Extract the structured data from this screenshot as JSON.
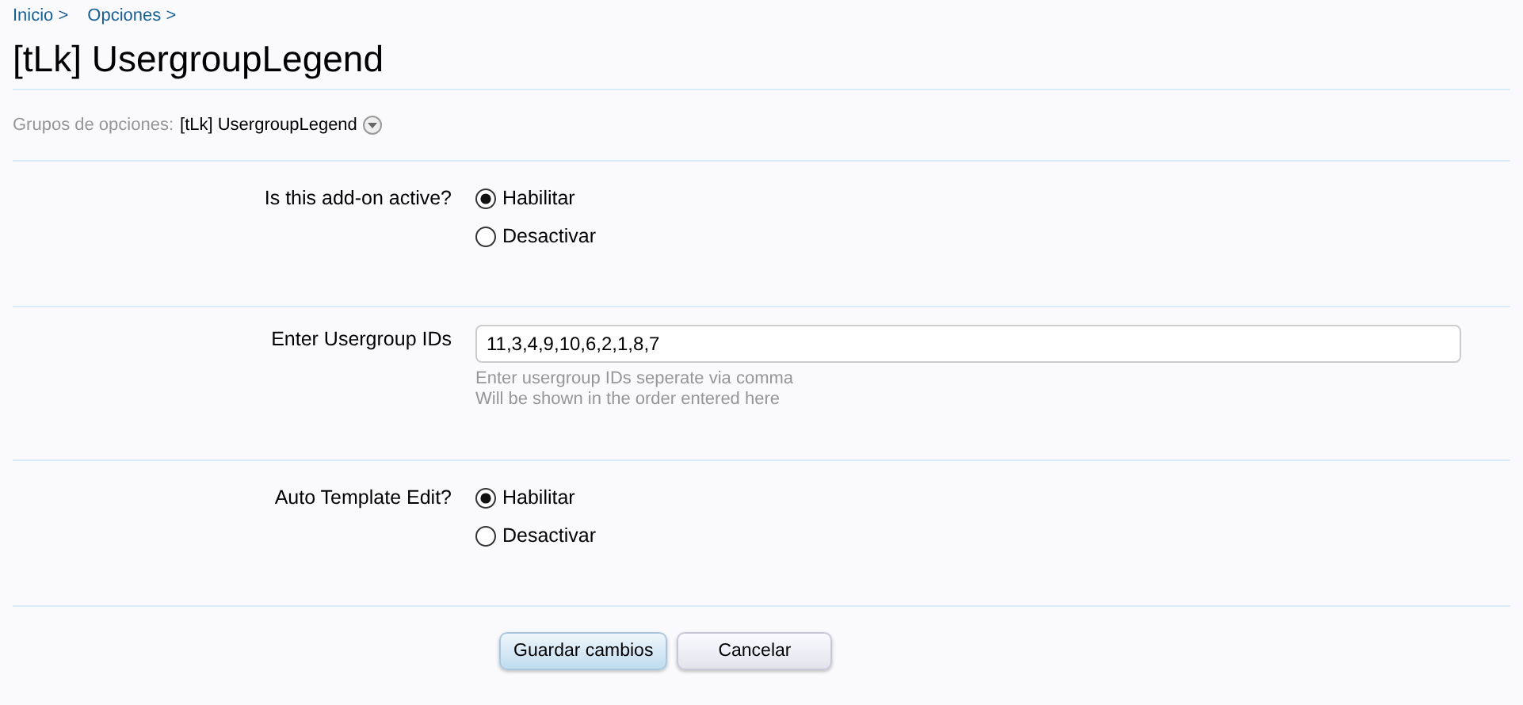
{
  "breadcrumb": [
    "Inicio >",
    "Opciones >"
  ],
  "title": "[tLk] UsergroupLegend",
  "option_group": {
    "label": "Grupos de opciones:",
    "value": "[tLk] UsergroupLegend"
  },
  "options": [
    {
      "kind": "radio",
      "label": "Is this add-on active?",
      "choices": [
        {
          "label": "Habilitar",
          "selected": true
        },
        {
          "label": "Desactivar",
          "selected": false
        }
      ]
    },
    {
      "kind": "text",
      "label": "Enter Usergroup IDs",
      "value": "11,3,4,9,10,6,2,1,8,7",
      "hints": [
        "Enter usergroup IDs seperate via comma",
        "Will be shown in the order entered here"
      ]
    },
    {
      "kind": "radio",
      "label": "Auto Template Edit?",
      "choices": [
        {
          "label": "Habilitar",
          "selected": true
        },
        {
          "label": "Desactivar",
          "selected": false
        }
      ]
    }
  ],
  "buttons": [
    {
      "label": "Guardar cambios",
      "kind": "primary"
    },
    {
      "label": "Cancelar",
      "kind": "secondary"
    }
  ]
}
